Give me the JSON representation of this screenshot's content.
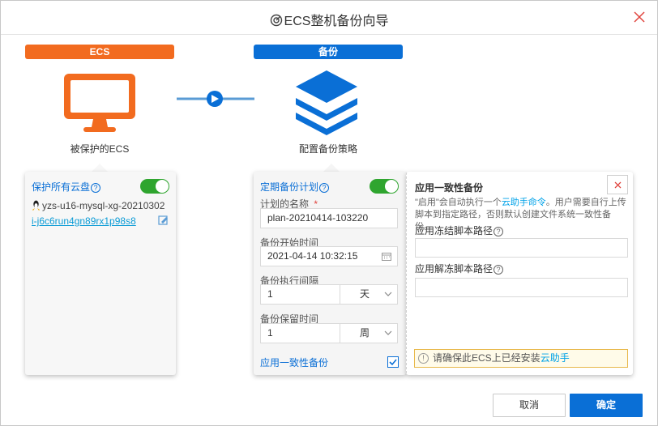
{
  "dialog": {
    "title": "ECS整机备份向导",
    "close_label": "×"
  },
  "steps": {
    "ecs": {
      "label": "ECS",
      "caption": "被保护的ECS",
      "color": "#f26b1f"
    },
    "backup": {
      "label": "备份",
      "caption": "配置备份策略",
      "color": "#0a6fd6"
    }
  },
  "left_panel": {
    "protect_all_label": "保护所有云盘",
    "protect_all_on": true,
    "instance_name": "yzs-u16-mysql-xg-20210302",
    "instance_id": "i-j6c6run4gn89rx1p98s8"
  },
  "plan_panel": {
    "schedule_label": "定期备份计划",
    "schedule_on": true,
    "plan_name_label": "计划的名称",
    "required_mark": "*",
    "plan_name_value": "plan-20210414-103220",
    "start_time_label": "备份开始时间",
    "start_time_value": "2021-04-14 10:32:15",
    "interval_label": "备份执行间隔",
    "interval_value": "1",
    "interval_unit": "天",
    "retention_label": "备份保留时间",
    "retention_value": "1",
    "retention_unit": "周",
    "consistency_label": "应用一致性备份",
    "consistency_checked": true
  },
  "consistency_panel": {
    "title": "应用一致性备份",
    "desc_part1": "\"启用\"会自动执行一个",
    "desc_link": "云助手命令",
    "desc_part2": "。用户需要自行上传脚本到指定路径，否则默认创建文件系统一致性备份。",
    "freeze_label": "应用冻结脚本路径",
    "freeze_value": "",
    "thaw_label": "应用解冻脚本路径",
    "thaw_value": "",
    "warning_text": "请确保此ECS上已经安装",
    "warning_link": "云助手"
  },
  "footer": {
    "cancel_label": "取消",
    "ok_label": "确定"
  },
  "colors": {
    "accent": "#0a6fd6",
    "orange": "#f26b1f",
    "toggle_on": "#2fa52f",
    "link": "#00a2e8"
  }
}
